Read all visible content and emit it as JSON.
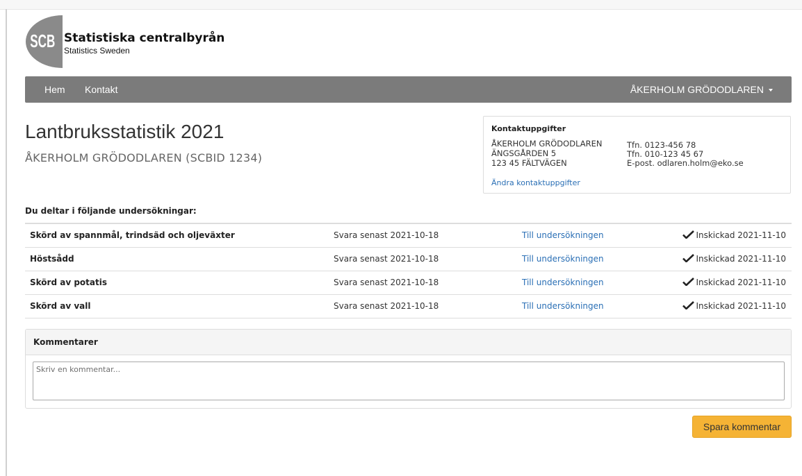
{
  "logo": {
    "mark": "SCB",
    "title": "Statistiska centralbyrån",
    "subtitle": "Statistics Sweden"
  },
  "nav": {
    "links": [
      "Hem",
      "Kontakt"
    ],
    "user": "ÅKERHOLM GRÖDODLAREN"
  },
  "page": {
    "title": "Lantbruksstatistik 2021",
    "subtitle": "ÅKERHOLM GRÖDODLAREN (SCBID 1234)"
  },
  "contact": {
    "title": "Kontaktuppgifter",
    "address": [
      "ÅKERHOLM GRÖDODLAREN",
      "ÄNGSGÅRDEN 5",
      "123 45 FÄLTVÄGEN"
    ],
    "details": [
      "Tfn. 0123-456 78",
      "Tfn. 010-123 45 67",
      "E-post. odlaren.holm@eko.se"
    ],
    "edit_link": "Ändra kontaktuppgifter"
  },
  "surveys": {
    "header": "Du deltar i följande undersökningar:",
    "rows": [
      {
        "name": "Skörd av spannmål, trindsäd och oljeväxter",
        "deadline": "Svara senast 2021-10-18",
        "link": "Till undersökningen",
        "status": "Inskickad 2021-11-10"
      },
      {
        "name": "Höstsådd",
        "deadline": "Svara senast 2021-10-18",
        "link": "Till undersökningen",
        "status": "Inskickad 2021-11-10"
      },
      {
        "name": "Skörd av potatis",
        "deadline": "Svara senast 2021-10-18",
        "link": "Till undersökningen",
        "status": "Inskickad 2021-11-10"
      },
      {
        "name": "Skörd av vall",
        "deadline": "Svara senast 2021-10-18",
        "link": "Till undersökningen",
        "status": "Inskickad 2021-11-10"
      }
    ]
  },
  "comments": {
    "title": "Kommentarer",
    "placeholder": "Skriv en kommentar...",
    "value": "",
    "save_label": "Spara kommentar"
  },
  "colors": {
    "navbar": "#7b7b7b",
    "link": "#2a6fb5",
    "button": "#f5b335"
  },
  "icons": {
    "status": "check-icon",
    "user_menu": "caret-down-icon"
  }
}
